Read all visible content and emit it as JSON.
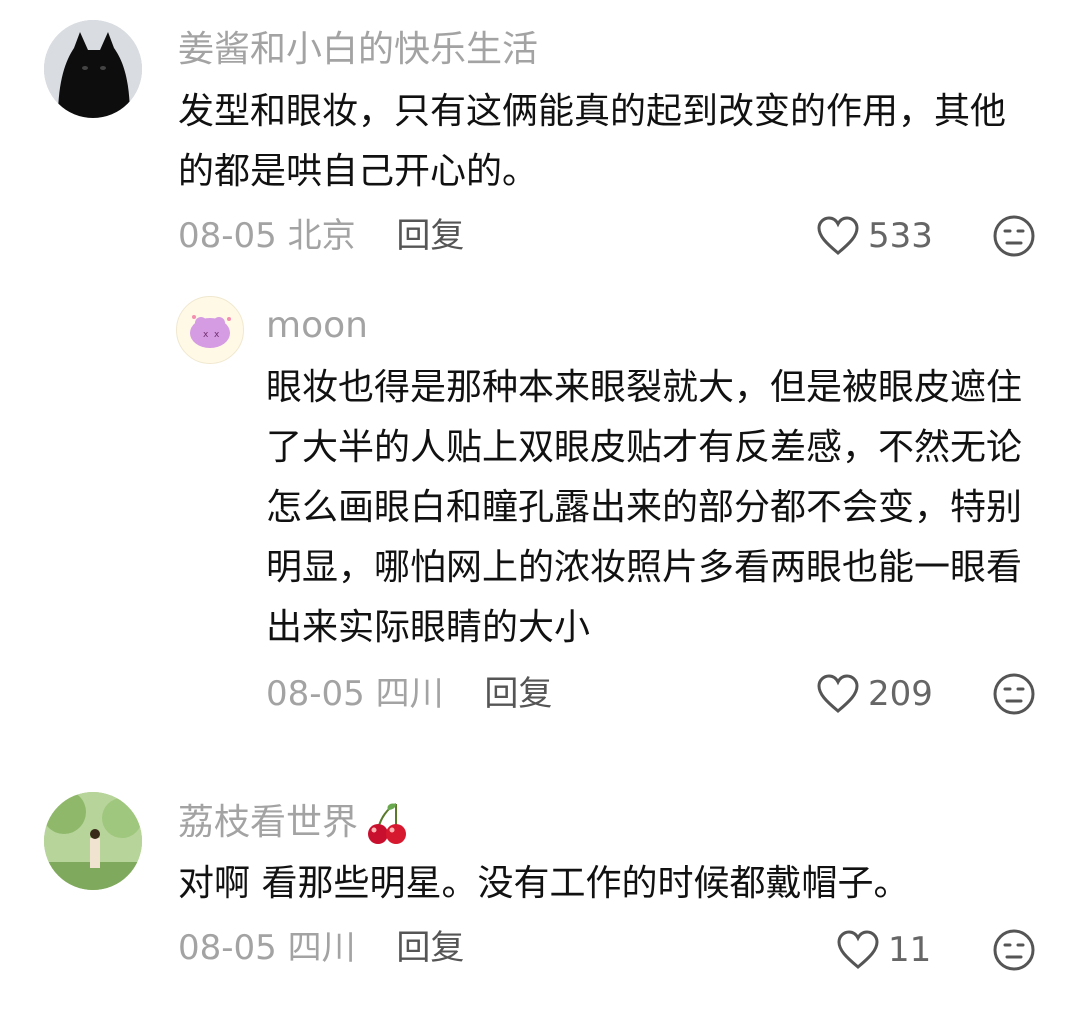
{
  "comments": [
    {
      "username": "姜酱和小白的快乐生活",
      "text": "发型和眼妆，只有这俩能真的起到改变的作用，其他的都是哄自己开心的。",
      "date": "08-05",
      "location": "北京",
      "reply_label": "回复",
      "likes": "533",
      "avatar_icon": "black-cat-avatar"
    },
    {
      "username": "moon",
      "text": "眼妆也得是那种本来眼裂就大，但是被眼皮遮住了大半的人贴上双眼皮贴才有反差感，不然无论怎么画眼白和瞳孔露出来的部分都不会变，特别明显，哪怕网上的浓妆照片多看两眼也能一眼看出来实际眼睛的大小",
      "date": "08-05",
      "location": "四川",
      "reply_label": "回复",
      "likes": "209",
      "avatar_icon": "pink-cartoon-avatar"
    },
    {
      "username": "荔枝看世界",
      "username_emoji": "cherry-icon",
      "text": "对啊 看那些明星。没有工作的时候都戴帽子。",
      "date": "08-05",
      "location": "四川",
      "reply_label": "回复",
      "likes": "11",
      "avatar_icon": "forest-scene-avatar"
    }
  ],
  "icons": {
    "like": "heart-outline-icon",
    "dislike": "neutral-face-icon"
  },
  "colors": {
    "username": "#a3a3a3",
    "text": "#111111",
    "meta": "#a3a3a3"
  }
}
